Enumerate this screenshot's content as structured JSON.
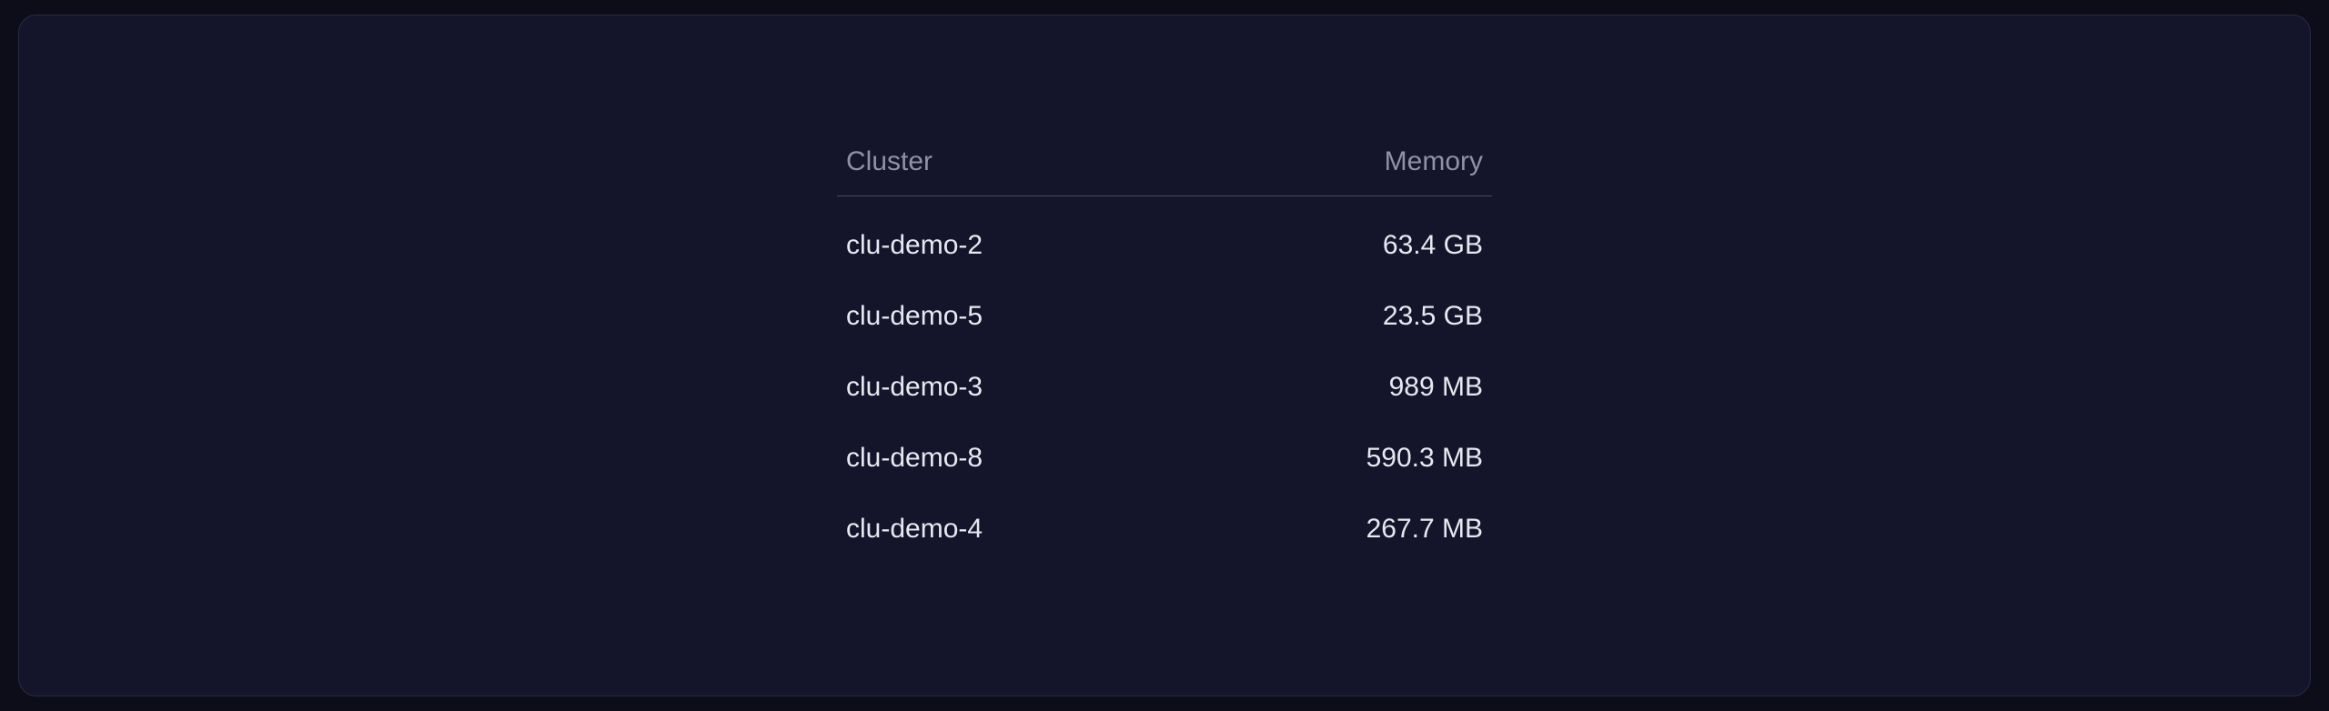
{
  "table": {
    "headers": {
      "cluster": "Cluster",
      "memory": "Memory"
    },
    "rows": [
      {
        "cluster": "clu-demo-2",
        "memory": "63.4 GB"
      },
      {
        "cluster": "clu-demo-5",
        "memory": "23.5 GB"
      },
      {
        "cluster": "clu-demo-3",
        "memory": "989 MB"
      },
      {
        "cluster": "clu-demo-8",
        "memory": "590.3 MB"
      },
      {
        "cluster": "clu-demo-4",
        "memory": "267.7 MB"
      }
    ]
  }
}
